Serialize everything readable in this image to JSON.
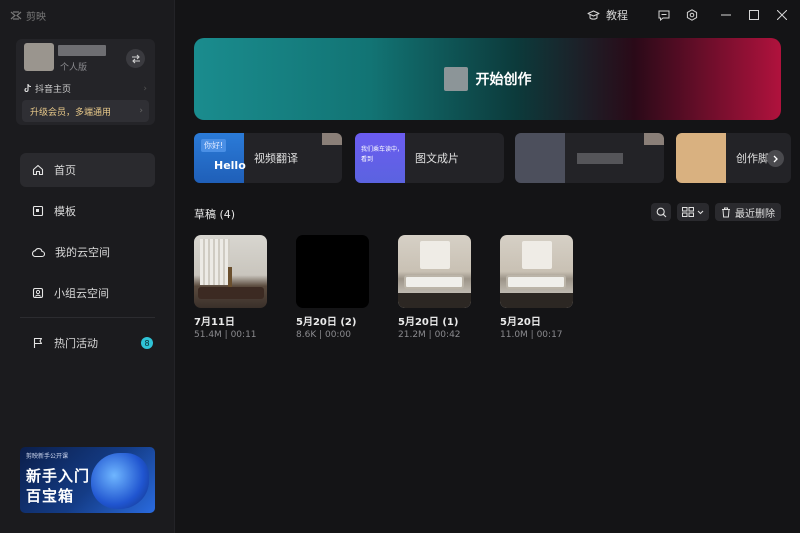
{
  "titlebar": {
    "app_name": "剪映",
    "tutorial_label": "教程"
  },
  "user": {
    "level": "个人版",
    "douyin_link": "抖音主页",
    "vip_promo": "升级会员，多端通用"
  },
  "nav": {
    "items": [
      {
        "label": "首页",
        "icon": "home-icon",
        "active": true
      },
      {
        "label": "模板",
        "icon": "template-icon",
        "active": false
      },
      {
        "label": "我的云空间",
        "icon": "cloud-icon",
        "active": false
      },
      {
        "label": "小组云空间",
        "icon": "team-cloud-icon",
        "active": false
      },
      {
        "label": "热门活动",
        "icon": "flag-icon",
        "active": false,
        "badge": "8"
      }
    ]
  },
  "promo": {
    "brand": "剪映新手公开课",
    "line1": "新手入门",
    "line2": "百宝箱"
  },
  "hero": {
    "label": "开始创作"
  },
  "tools": [
    {
      "label": "视频翻译",
      "thumb_bubble": "你好!",
      "thumb_text": "Hello"
    },
    {
      "label": "图文成片",
      "thumb_text": "我们乘车读中，看到"
    },
    {
      "label": ""
    },
    {
      "label": "创作脚"
    }
  ],
  "drafts": {
    "title": "草稿",
    "count": "(4)",
    "delete_label": "最近删除",
    "items": [
      {
        "name": "7月11日",
        "size": "51.4M",
        "duration": "00:11"
      },
      {
        "name": "5月20日 (2)",
        "size": "8.6K",
        "duration": "00:00"
      },
      {
        "name": "5月20日 (1)",
        "size": "21.2M",
        "duration": "00:42"
      },
      {
        "name": "5月20日",
        "size": "11.0M",
        "duration": "00:17"
      }
    ]
  },
  "colors": {
    "accent": "#2fc3d6",
    "vip_text": "#e8c98a",
    "hero_left": "#1a8c8e",
    "hero_right": "#b0123d"
  }
}
